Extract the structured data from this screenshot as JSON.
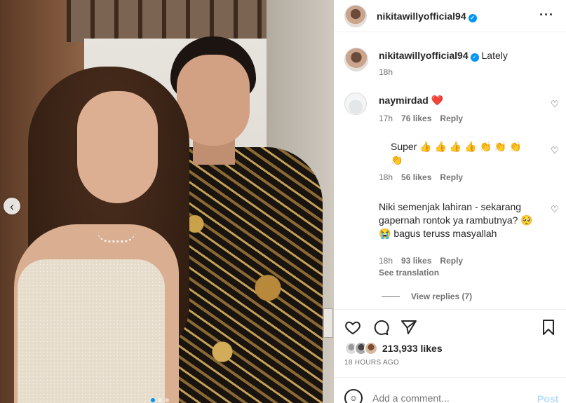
{
  "post": {
    "author": "nikitawillyofficial94",
    "caption_text": "Lately",
    "caption_age": "18h",
    "likes": "213,933 likes",
    "timestamp": "18 HOURS AGO"
  },
  "comments": [
    {
      "user": "naymirdad",
      "text": "❤️",
      "age": "17h",
      "likes": "76 likes",
      "reply": "Reply"
    },
    {
      "user": "",
      "text": "Super 👍 👍 👍 👍 👏 👏 👏 👏",
      "age": "18h",
      "likes": "56 likes",
      "reply": "Reply"
    },
    {
      "user": "",
      "text": "Niki semenjak lahiran - sekarang gapernah rontok ya rambutnya? 🥺 😭 bagus teruss masyallah",
      "age": "18h",
      "likes": "93 likes",
      "reply": "Reply",
      "see_translation": "See translation"
    }
  ],
  "view_replies": "View replies (7)",
  "add_comment": {
    "placeholder": "Add a comment...",
    "post_label": "Post"
  },
  "icons": {
    "verified": "verified-badge-icon",
    "more": "more-options-icon",
    "like": "heart-icon",
    "comment": "comment-icon",
    "share": "send-icon",
    "save": "bookmark-icon",
    "emoji": "emoji-icon",
    "prev": "chevron-left-icon"
  },
  "colors": {
    "accent": "#0095f6",
    "post_disabled": "#b3dbff",
    "secondary_text": "#737373"
  }
}
